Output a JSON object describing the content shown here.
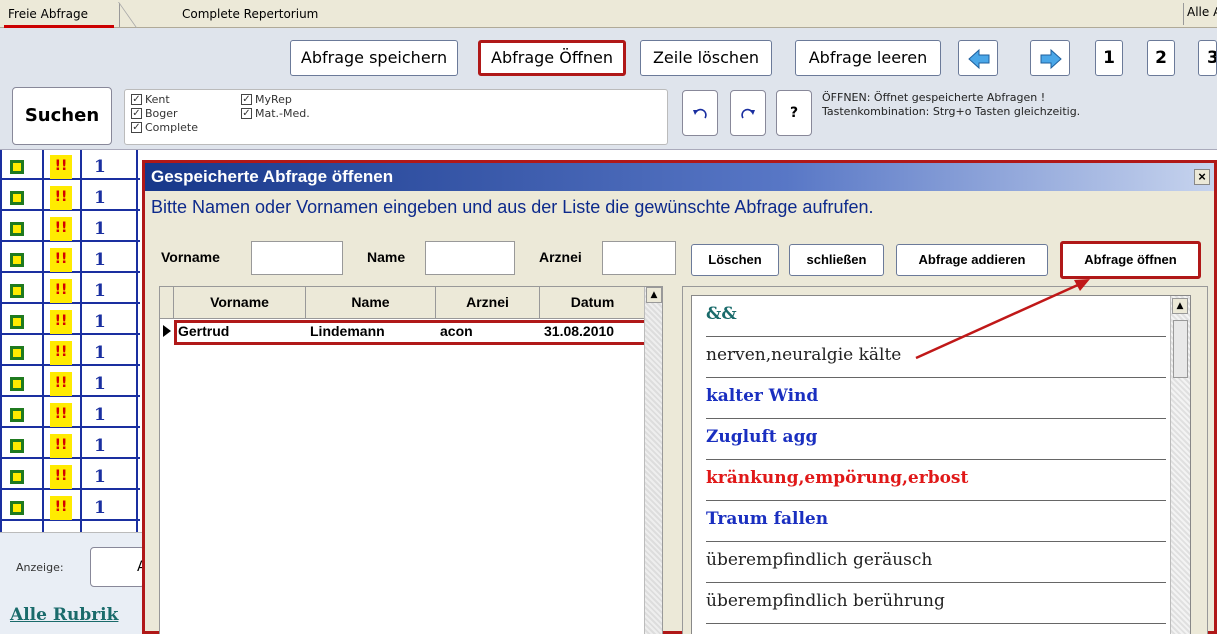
{
  "tabs": [
    "Freie Abfrage",
    "Complete Repertorium"
  ],
  "top_right_label": "Alle A",
  "toolbar": {
    "save": "Abfrage speichern",
    "open": "Abfrage Öffnen",
    "delete_row": "Zeile löschen",
    "clear": "Abfrage leeren",
    "pages": [
      "1",
      "2",
      "3"
    ]
  },
  "search": {
    "button": "Suchen",
    "sources": [
      "Kent",
      "Boger",
      "Complete",
      "MyRep",
      "Mat.-Med."
    ],
    "undo_icon": "undo-icon",
    "redo_icon": "redo-icon",
    "help": "?",
    "hint_line1": "ÖFFNEN: Öffnet gespeicherte Abfragen !",
    "hint_line2": "Tastenkombination:  Strg+o  Tasten gleichzeitig."
  },
  "grid": {
    "rows": [
      {
        "mark": "!!",
        "value": "1"
      },
      {
        "mark": "!!",
        "value": "1"
      },
      {
        "mark": "!!",
        "value": "1"
      },
      {
        "mark": "!!",
        "value": "1"
      },
      {
        "mark": "!!",
        "value": "1"
      },
      {
        "mark": "!!",
        "value": "1"
      },
      {
        "mark": "!!",
        "value": "1"
      },
      {
        "mark": "!!",
        "value": "1"
      },
      {
        "mark": "!!",
        "value": "1"
      },
      {
        "mark": "!!",
        "value": "1"
      },
      {
        "mark": "!!",
        "value": "1"
      },
      {
        "mark": "!!",
        "value": "1"
      }
    ]
  },
  "bottom": {
    "anzeige_label": "Anzeige:",
    "anzeige_value": "A",
    "link": "Alle Rubrik"
  },
  "dialog": {
    "title": "Gespeicherte Abfrage öffenen",
    "close": "×",
    "instruction": "Bitte Namen oder Vornamen eingeben und aus der Liste die gewünschte Abfrage aufrufen.",
    "filters": {
      "vorname": "Vorname",
      "name": "Name",
      "arznei": "Arznei"
    },
    "buttons": {
      "delete": "Löschen",
      "close": "schließen",
      "add": "Abfrage addieren",
      "open": "Abfrage öffnen"
    },
    "table": {
      "headers": [
        "Vorname",
        "Name",
        "Arznei",
        "Datum"
      ],
      "rows": [
        {
          "vorname": "Gertrud",
          "name": "Lindemann",
          "arznei": "acon",
          "datum": "31.08.2010"
        }
      ]
    },
    "queries": [
      {
        "text": "&&",
        "color": "#1a6b6b",
        "bold": true
      },
      {
        "text": "nerven,neuralgie kälte",
        "color": "#222222",
        "bold": false
      },
      {
        "text": "kalter Wind",
        "color": "#1a2fc0",
        "bold": true
      },
      {
        "text": "Zugluft agg",
        "color": "#1a2fc0",
        "bold": true
      },
      {
        "text": "kränkung,empörung,erbost",
        "color": "#e01818",
        "bold": true
      },
      {
        "text": "Traum fallen",
        "color": "#1a2fc0",
        "bold": true
      },
      {
        "text": "überempfindlich geräusch",
        "color": "#222222",
        "bold": false
      },
      {
        "text": "überempfindlich berührung",
        "color": "#222222",
        "bold": false
      }
    ]
  },
  "colors": {
    "highlight": "#b01818",
    "title_bar": "#17378a",
    "grid_lines": "#1a2fa0"
  }
}
